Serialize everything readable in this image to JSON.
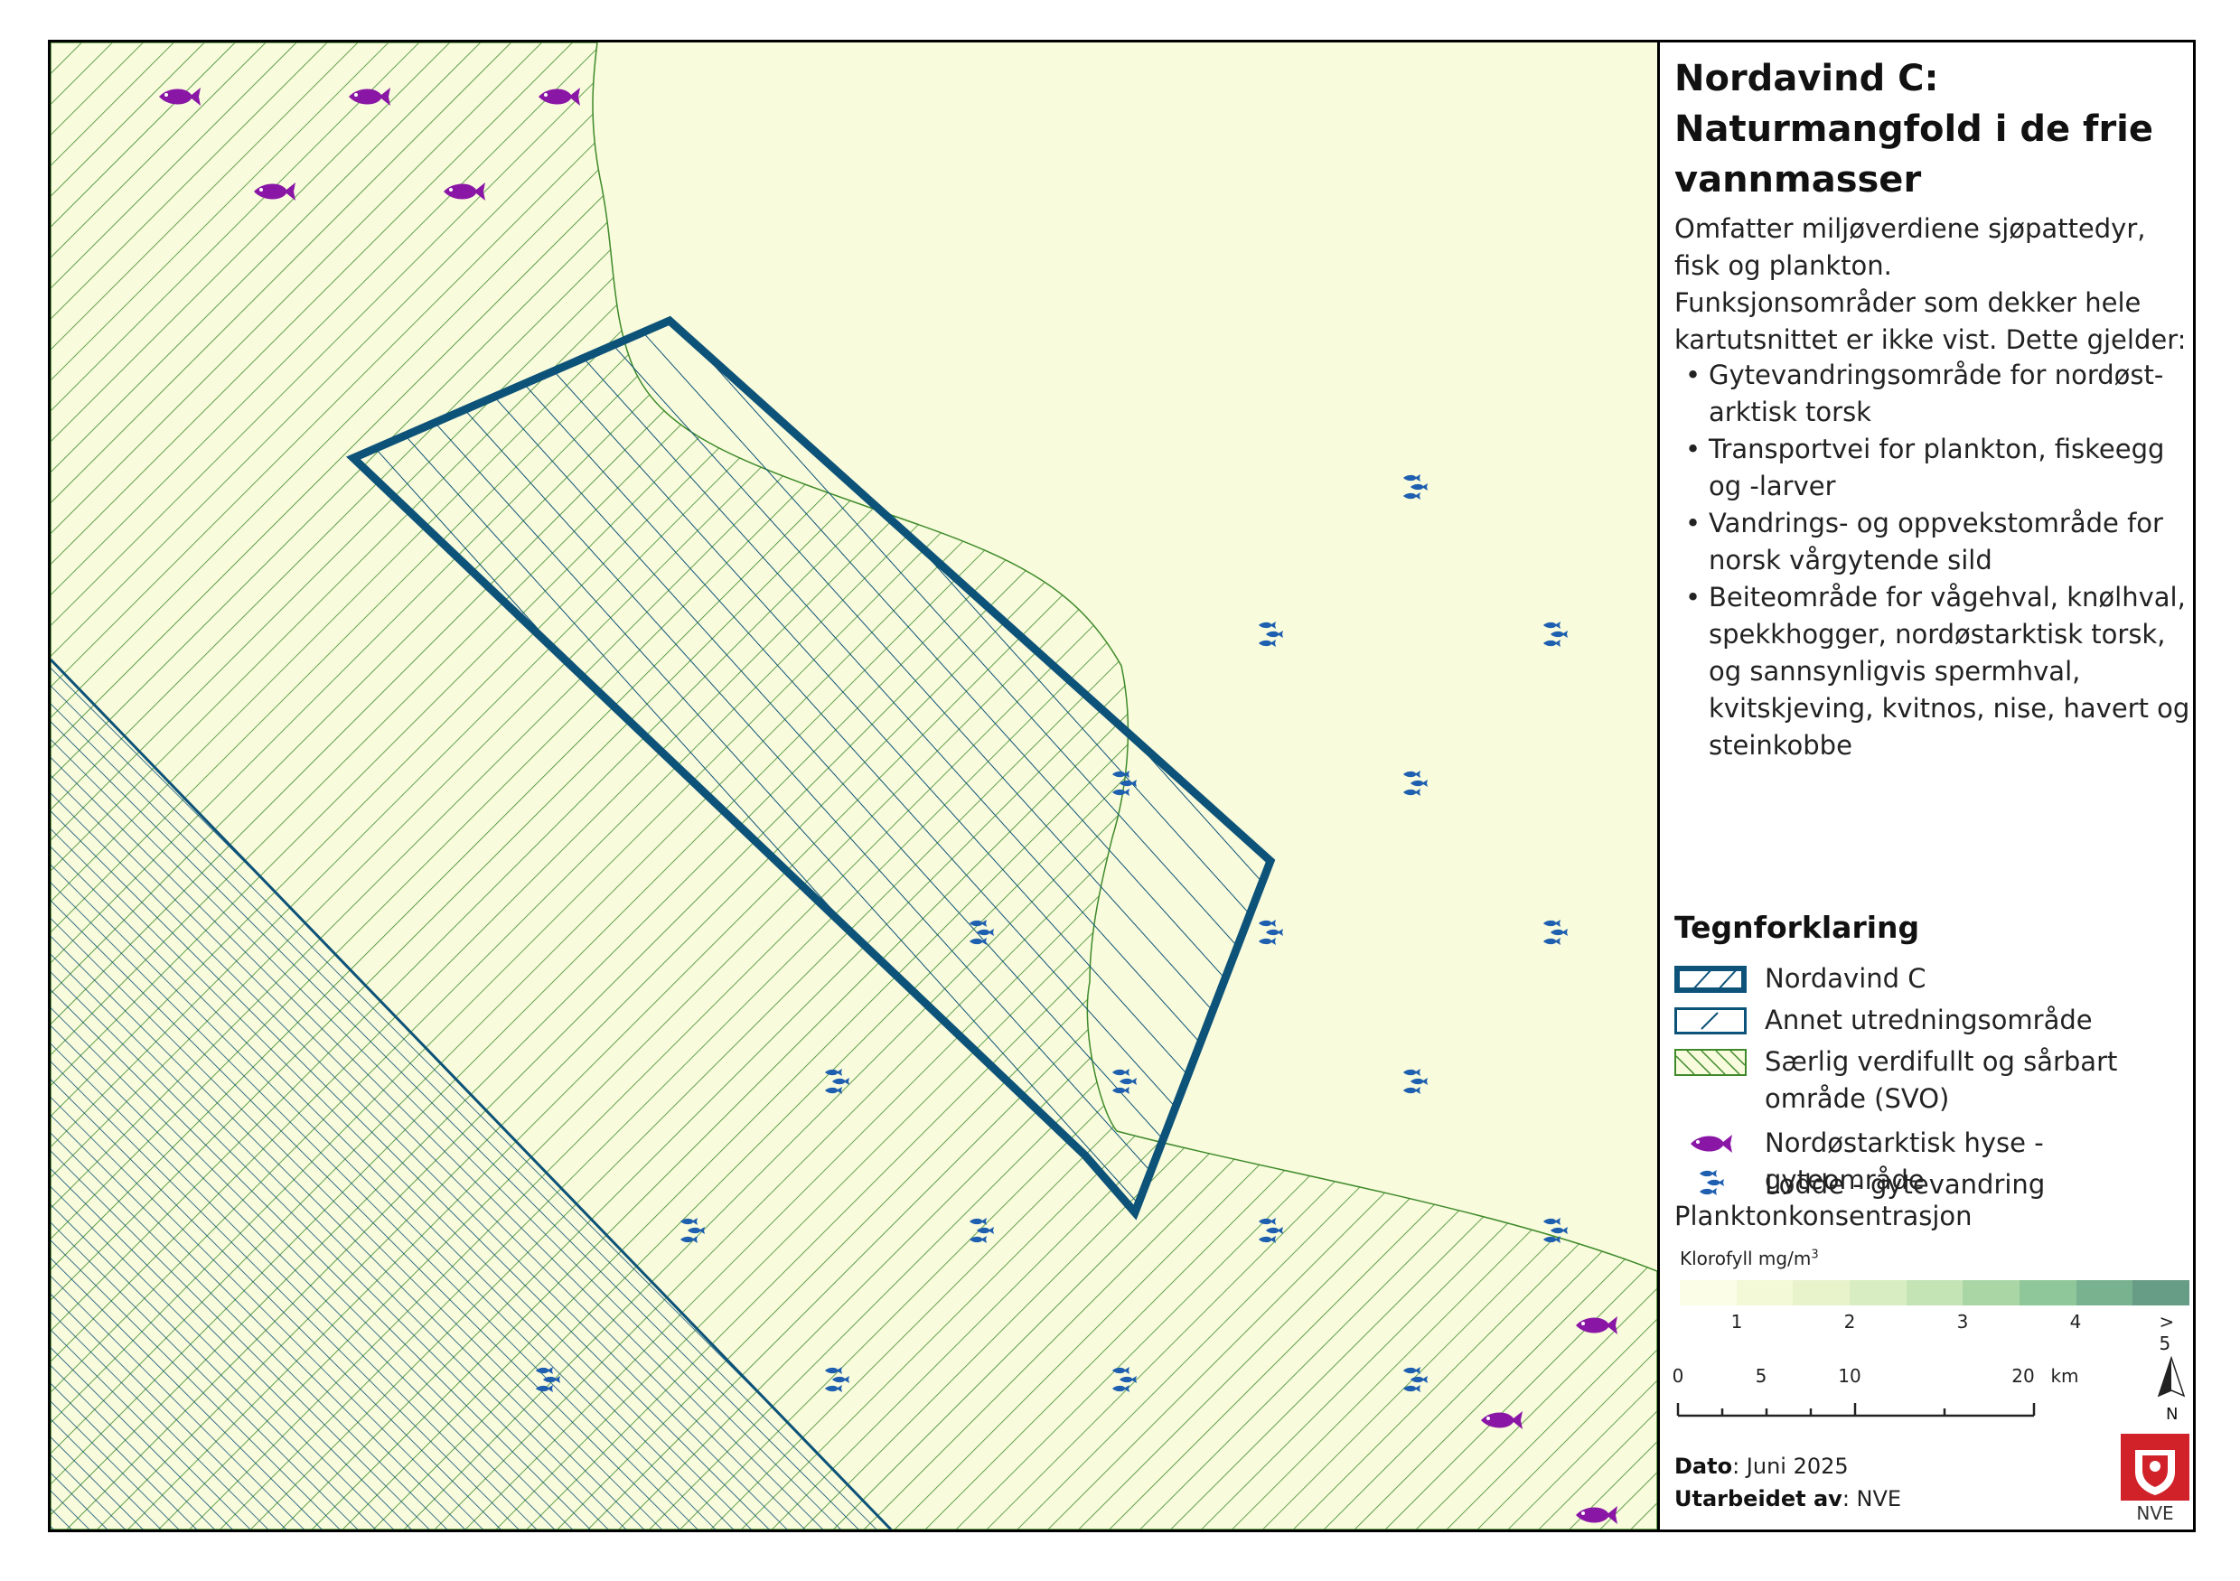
{
  "panel": {
    "title": "Nordavind C: Naturmangfold i de frie vannmasser",
    "subtitle": "Omfatter miljøverdiene sjøpattedyr, fisk og plankton.",
    "note": "Funksjonsområder som dekker hele kartutsnittet er ikke vist. Dette gjelder:",
    "bullets": [
      "Gytevandringsområde for nordøst-arktisk torsk",
      "Transportvei for plankton, fiskeegg og -larver",
      "Vandrings- og oppvekstområde for norsk vårgytende sild",
      "Beiteområde for vågehval, knølhval, spekkhogger, nordøstarktisk torsk, og sannsynligvis spermhval, kvitskjeving, kvitnos, nise, havert og steinkobbe"
    ]
  },
  "legend": {
    "title": "Tegnforklaring",
    "items": [
      {
        "label": "Nordavind C"
      },
      {
        "label": "Annet utredningsområde"
      },
      {
        "label": "Særlig verdifullt og sårbart område (SVO)"
      },
      {
        "label": "Nordøstarktisk hyse - gyteområde"
      },
      {
        "label": "Lodde - gytevandring"
      }
    ],
    "plankton_title": "Planktonkonsentrasjon",
    "chl_label": "Klorofyll mg/m",
    "chl_unit_sup": "3",
    "ramp_colors": [
      "#fbfde6",
      "#f3f8d6",
      "#e8f3cc",
      "#d8edc2",
      "#c4e4b6",
      "#aad6a6",
      "#8fc79a",
      "#78b28f",
      "#679c86"
    ],
    "ramp_ticks": [
      "1",
      "2",
      "3",
      "4",
      "> 5"
    ]
  },
  "scalebar": {
    "labels": [
      "0",
      "5",
      "10",
      "20"
    ],
    "unit": "km",
    "north": "N"
  },
  "footer": {
    "date_label": "Dato",
    "date_value": ": Juni 2025",
    "author_label": "Utarbeidet av",
    "author_value": ": NVE",
    "logo_text": "NVE"
  },
  "colors": {
    "sea": "#f8fbdc",
    "svo_hatch": "#3e8a2a",
    "area_outline": "#0d5278",
    "hyse": "#8a16a6",
    "lodde": "#1f5fb0"
  }
}
